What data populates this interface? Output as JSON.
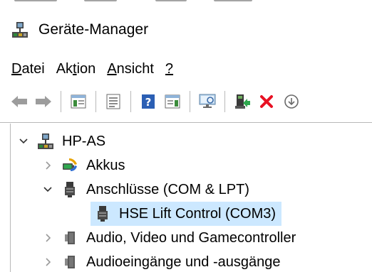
{
  "window": {
    "title": "Geräte-Manager",
    "app_icon": "device-manager-icon"
  },
  "menu": {
    "items": [
      {
        "label": "Datei",
        "access_key": "D"
      },
      {
        "label": "Aktion",
        "access_key": "t"
      },
      {
        "label": "Ansicht",
        "access_key": "A"
      },
      {
        "label": "?",
        "access_key": "?"
      }
    ]
  },
  "toolbar": {
    "buttons": [
      {
        "icon": "back-arrow-icon",
        "enabled": false
      },
      {
        "icon": "forward-arrow-icon",
        "enabled": false
      },
      {
        "icon": "show-hide-console-tree-icon",
        "enabled": true
      },
      {
        "icon": "properties-icon",
        "enabled": true
      },
      {
        "icon": "help-icon",
        "enabled": true
      },
      {
        "icon": "action-pane-icon",
        "enabled": true
      },
      {
        "icon": "scan-hardware-changes-icon",
        "enabled": true
      },
      {
        "icon": "update-driver-icon",
        "enabled": true
      },
      {
        "icon": "uninstall-device-icon",
        "enabled": true
      },
      {
        "icon": "download-icon",
        "enabled": true
      }
    ]
  },
  "tree": {
    "nodes": [
      {
        "label": "HP-AS",
        "level": 0,
        "expanded": true,
        "icon": "computer-icon",
        "selected": false
      },
      {
        "label": "Akkus",
        "level": 1,
        "expanded": false,
        "icon": "battery-icon",
        "selected": false
      },
      {
        "label": "Anschlüsse (COM & LPT)",
        "level": 1,
        "expanded": true,
        "icon": "port-icon",
        "selected": false
      },
      {
        "label": "HSE Lift Control (COM3)",
        "level": 2,
        "expanded": null,
        "icon": "port-icon",
        "selected": true
      },
      {
        "label": "Audio, Video und Gamecontroller",
        "level": 1,
        "expanded": false,
        "icon": "speaker-icon",
        "selected": false
      },
      {
        "label": "Audioeingänge und -ausgänge",
        "level": 1,
        "expanded": false,
        "icon": "speaker-icon",
        "selected": false
      }
    ]
  },
  "colors": {
    "selection": "#cce8ff",
    "separator": "#b9b9b9",
    "error_red": "#e81123",
    "help_blue": "#2b5fb4"
  }
}
